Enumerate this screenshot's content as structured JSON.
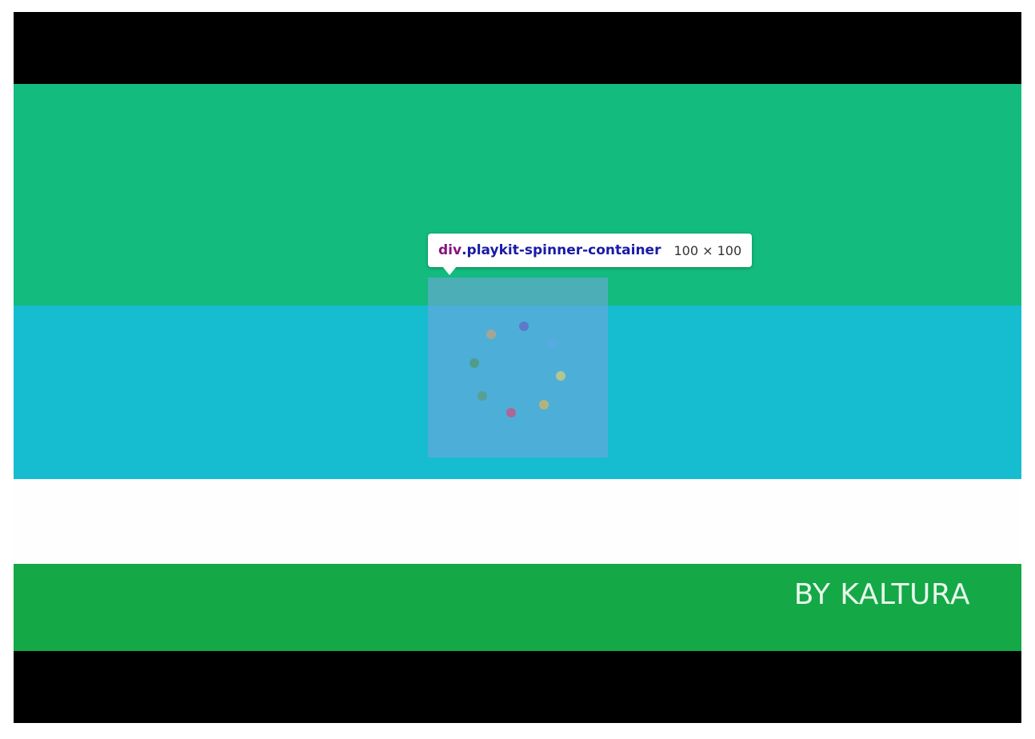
{
  "video": {
    "colors": {
      "letterbox": "#000000",
      "band_green_top": "#13bb7e",
      "band_cyan": "#16bcd0",
      "band_white": "#fefefe",
      "band_green_bottom": "#14a846"
    },
    "brand_text": "BY KALTURA"
  },
  "spinner": {
    "dot_colors": [
      "#6270c8",
      "#5aa8e6",
      "#c4c986",
      "#c7b46e",
      "#c05a8a",
      "#5a9e8a",
      "#4f9a7c",
      "#b3a58a"
    ]
  },
  "inspector_tooltip": {
    "tag": "div",
    "class_name": ".playkit-spinner-container",
    "dimensions": "100 × 100"
  }
}
